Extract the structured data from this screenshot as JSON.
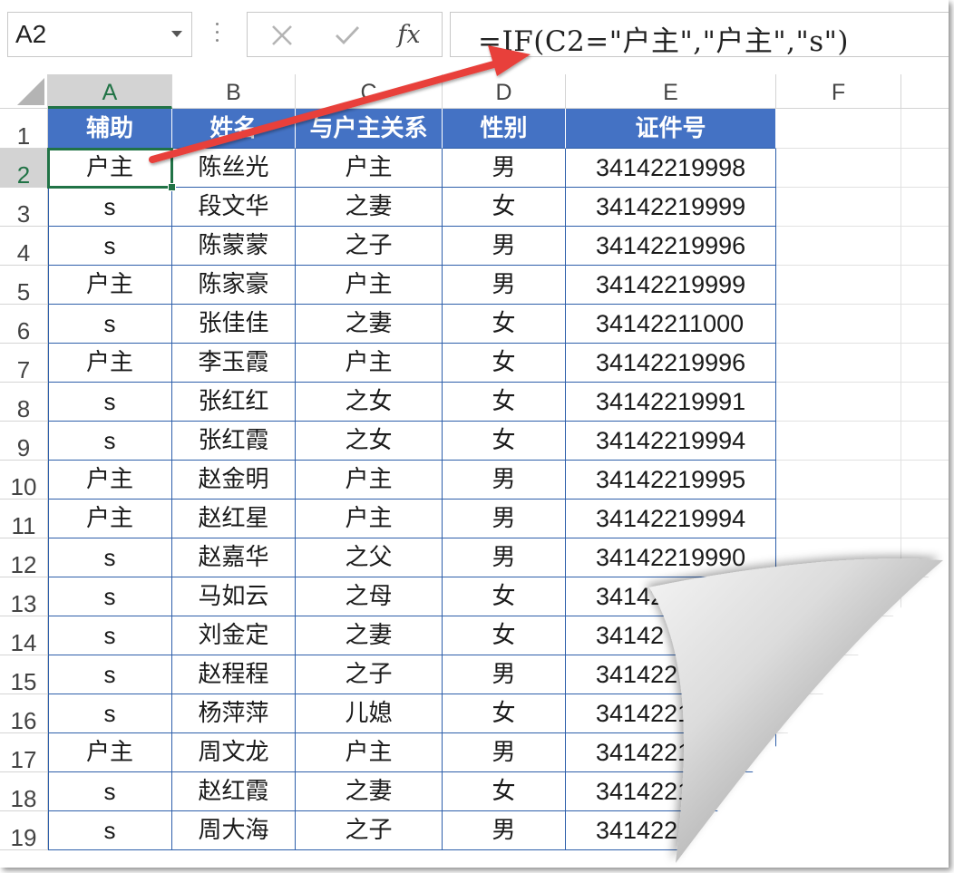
{
  "formula_bar": {
    "name_box": "A2",
    "cancel_icon": "cancel-icon",
    "enter_icon": "check-icon",
    "fx_label": "fx",
    "formula": "=IF(C2=\"户主\",\"户主\",\"s\")"
  },
  "columns": [
    "A",
    "B",
    "C",
    "D",
    "E",
    "F"
  ],
  "rows": [
    "1",
    "2",
    "3",
    "4",
    "5",
    "6",
    "7",
    "8",
    "9",
    "10",
    "11",
    "12",
    "13",
    "14",
    "15",
    "16",
    "17",
    "18",
    "19"
  ],
  "table": {
    "headers": [
      "辅助",
      "姓名",
      "与户主关系",
      "性别",
      "证件号"
    ],
    "data": [
      [
        "户主",
        "陈丝光",
        "户主",
        "男",
        "34142219998"
      ],
      [
        "s",
        "段文华",
        "之妻",
        "女",
        "34142219999"
      ],
      [
        "s",
        "陈蒙蒙",
        "之子",
        "男",
        "34142219996"
      ],
      [
        "户主",
        "陈家豪",
        "户主",
        "男",
        "34142219999"
      ],
      [
        "s",
        "张佳佳",
        "之妻",
        "女",
        "34142211000"
      ],
      [
        "户主",
        "李玉霞",
        "户主",
        "女",
        "34142219996"
      ],
      [
        "s",
        "张红红",
        "之女",
        "女",
        "34142219991"
      ],
      [
        "s",
        "张红霞",
        "之女",
        "女",
        "34142219994"
      ],
      [
        "户主",
        "赵金明",
        "户主",
        "男",
        "34142219995"
      ],
      [
        "户主",
        "赵红星",
        "户主",
        "男",
        "34142219994"
      ],
      [
        "s",
        "赵嘉华",
        "之父",
        "男",
        "34142219990"
      ],
      [
        "s",
        "马如云",
        "之母",
        "女",
        "34142"
      ],
      [
        "s",
        "刘金定",
        "之妻",
        "女",
        "34142"
      ],
      [
        "s",
        "赵程程",
        "之子",
        "男",
        "341422"
      ],
      [
        "s",
        "杨萍萍",
        "儿媳",
        "女",
        "3414221"
      ],
      [
        "户主",
        "周文龙",
        "户主",
        "男",
        "3414221"
      ],
      [
        "s",
        "赵红霞",
        "之妻",
        "女",
        "3414221"
      ],
      [
        "s",
        "周大海",
        "之子",
        "男",
        "3414221"
      ]
    ]
  },
  "selected_cell": "A2",
  "colors": {
    "header_fill": "#4472c4",
    "header_text": "#ffffff",
    "selection": "#217346",
    "arrow": "#e8413a"
  }
}
